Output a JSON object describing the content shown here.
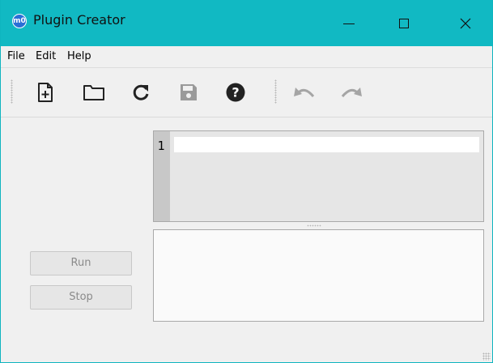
{
  "window": {
    "title": "Plugin Creator",
    "app_icon_text": "m0",
    "accent_color": "#11b9c3",
    "controls": {
      "minimize_icon": "minimize-icon",
      "maximize_icon": "maximize-icon",
      "close_icon": "close-icon"
    }
  },
  "menu": {
    "items": [
      {
        "label": "File"
      },
      {
        "label": "Edit"
      },
      {
        "label": "Help"
      }
    ]
  },
  "toolbar": {
    "buttons": [
      {
        "icon": "new-file-icon",
        "enabled": true
      },
      {
        "icon": "open-folder-icon",
        "enabled": true
      },
      {
        "icon": "reload-icon",
        "enabled": true
      },
      {
        "icon": "save-icon",
        "enabled": false
      },
      {
        "icon": "help-icon",
        "enabled": true
      },
      {
        "icon": "undo-icon",
        "enabled": false
      },
      {
        "icon": "redo-icon",
        "enabled": false
      }
    ]
  },
  "controls": {
    "run_label": "Run",
    "stop_label": "Stop"
  },
  "editor": {
    "line_number": "1",
    "content": ""
  },
  "output": {
    "content": ""
  }
}
